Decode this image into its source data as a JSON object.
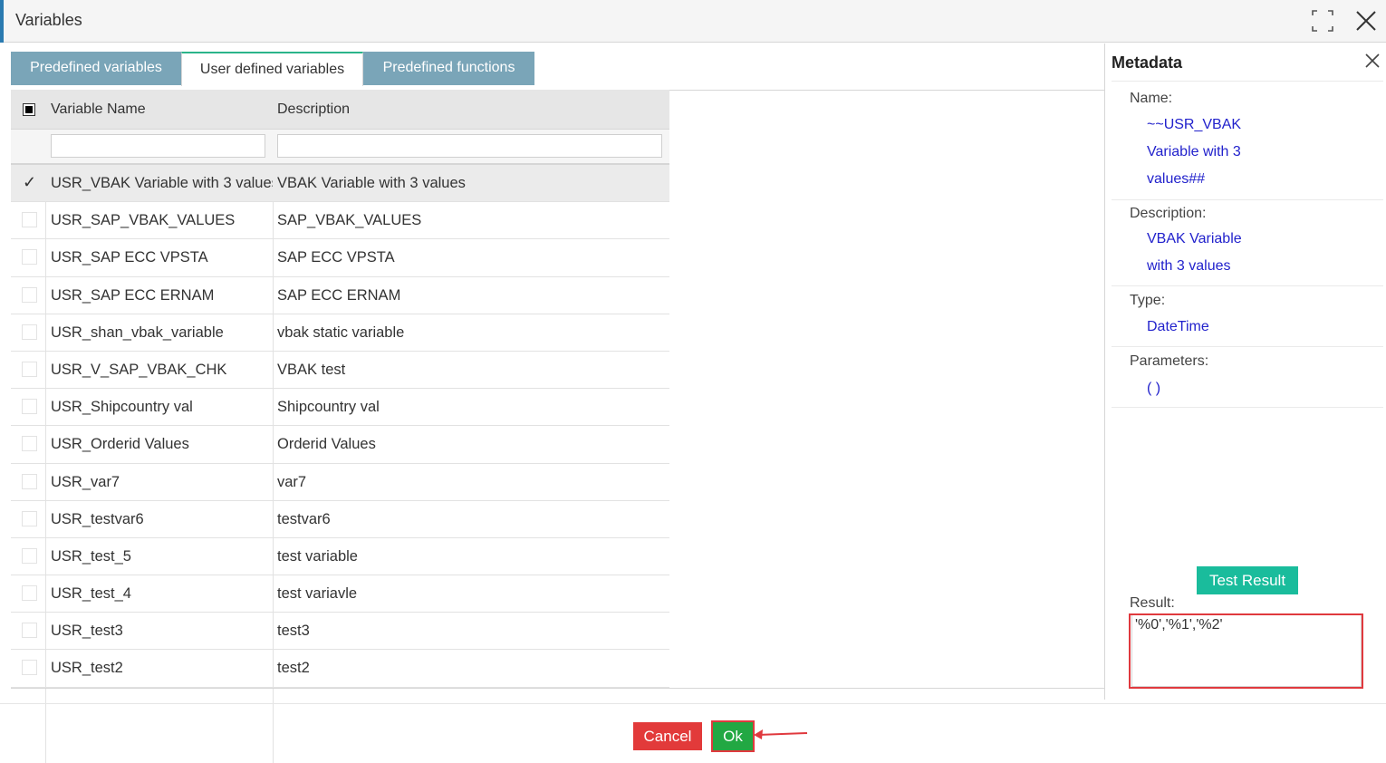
{
  "window": {
    "title": "Variables",
    "maximize_icon": "maximize-icon",
    "close_icon": "close-icon"
  },
  "tabs": [
    {
      "label": "Predefined variables",
      "active": false
    },
    {
      "label": "User defined variables",
      "active": true
    },
    {
      "label": "Predefined functions",
      "active": false
    }
  ],
  "grid": {
    "columns": {
      "name": "Variable Name",
      "description": "Description"
    },
    "filters": {
      "name": "",
      "description": ""
    },
    "rows": [
      {
        "name": "USR_VBAK Variable with 3 values",
        "description": "VBAK Variable with 3 values",
        "checked": true
      },
      {
        "name": "USR_SAP_VBAK_VALUES",
        "description": "SAP_VBAK_VALUES",
        "checked": false
      },
      {
        "name": "USR_SAP ECC VPSTA",
        "description": "SAP ECC VPSTA",
        "checked": false
      },
      {
        "name": "USR_SAP ECC ERNAM",
        "description": "SAP ECC ERNAM",
        "checked": false
      },
      {
        "name": "USR_shan_vbak_variable",
        "description": "vbak static variable",
        "checked": false
      },
      {
        "name": "USR_V_SAP_VBAK_CHK",
        "description": "VBAK test",
        "checked": false
      },
      {
        "name": "USR_Shipcountry val",
        "description": "Shipcountry val",
        "checked": false
      },
      {
        "name": "USR_Orderid Values",
        "description": "Orderid Values",
        "checked": false
      },
      {
        "name": "USR_var7",
        "description": "var7",
        "checked": false
      },
      {
        "name": "USR_testvar6",
        "description": "testvar6",
        "checked": false
      },
      {
        "name": "USR_test_5",
        "description": "test variable",
        "checked": false
      },
      {
        "name": "USR_test_4",
        "description": "test variavle",
        "checked": false
      },
      {
        "name": "USR_test3",
        "description": "test3",
        "checked": false
      },
      {
        "name": "USR_test2",
        "description": "test2",
        "checked": false
      }
    ]
  },
  "metadata": {
    "title": "Metadata",
    "name_label": "Name:",
    "name_value_line1": "~~USR_VBAK",
    "name_value_line2": "Variable with 3",
    "name_value_line3": "values##",
    "description_label": "Description:",
    "description_value_line1": "VBAK Variable",
    "description_value_line2": "with 3 values",
    "type_label": "Type:",
    "type_value": "DateTime",
    "parameters_label": "Parameters:",
    "parameters_value": "( )",
    "test_button": "Test Result",
    "result_label": "Result:",
    "result_value": "'%0','%1','%2'"
  },
  "footer": {
    "cancel": "Cancel",
    "ok": "Ok"
  },
  "colors": {
    "accent": "#2a7ab0",
    "tab_inactive": "#7aa5b8",
    "test_button": "#1abc9c",
    "cancel": "#e23a3a",
    "ok": "#22a843",
    "annotation": "#e0393e",
    "metadata_value": "#2222cc"
  }
}
